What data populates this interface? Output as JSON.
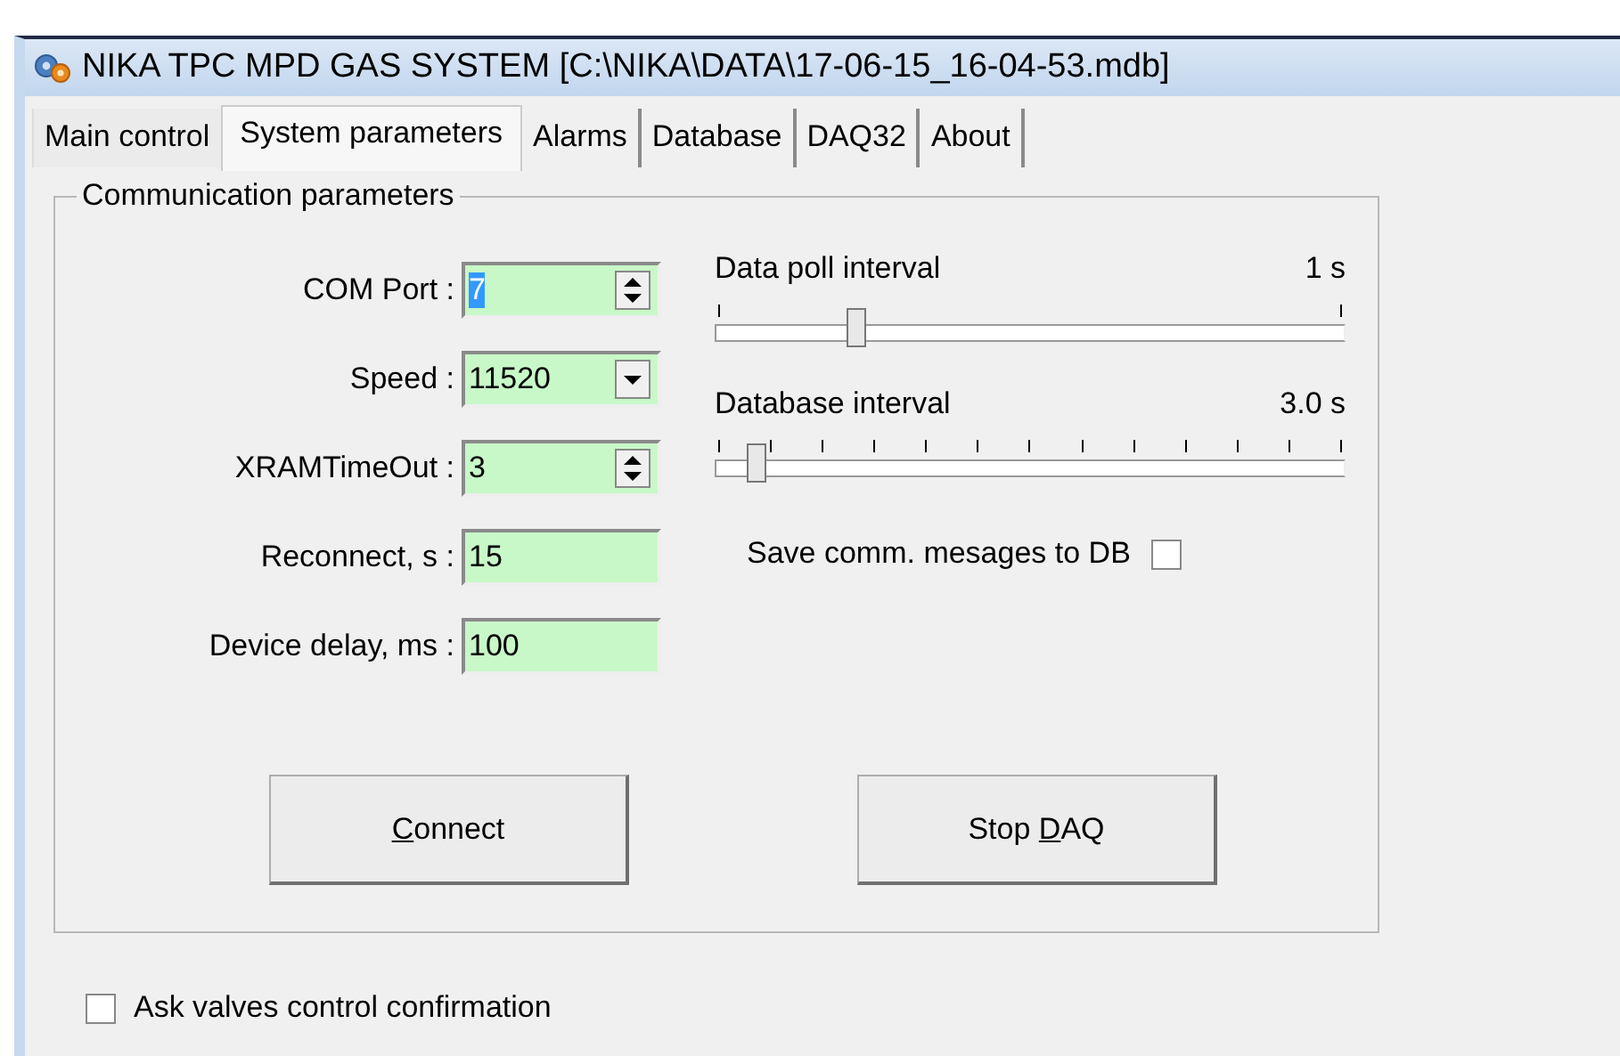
{
  "window": {
    "title": "NIKA TPC MPD GAS SYSTEM [C:\\NIKA\\DATA\\17-06-15_16-04-53.mdb]"
  },
  "tabs": [
    {
      "label": "Main control",
      "selected": false
    },
    {
      "label": "System parameters",
      "selected": true
    },
    {
      "label": "Alarms",
      "selected": false
    },
    {
      "label": "Database",
      "selected": false
    },
    {
      "label": "DAQ32",
      "selected": false
    },
    {
      "label": "About",
      "selected": false
    }
  ],
  "group": {
    "title": "Communication parameters",
    "fields": [
      {
        "label": "COM Port :",
        "kind": "spin",
        "value": "7",
        "text_selected": true
      },
      {
        "label": "Speed :",
        "kind": "combo",
        "value": "11520",
        "text_selected": false
      },
      {
        "label": "XRAMTimeOut :",
        "kind": "spin",
        "value": "3",
        "text_selected": false
      },
      {
        "label": "Reconnect, s :",
        "kind": "text",
        "value": "15",
        "text_selected": false
      },
      {
        "label": "Device delay, ms :",
        "kind": "text",
        "value": "100",
        "text_selected": false
      }
    ],
    "sliders": [
      {
        "label": "Data poll interval",
        "reading": "1 s",
        "level": 0.21
      },
      {
        "label": "Database interval",
        "reading": "3.0 s",
        "level": 0.05
      }
    ],
    "save_messages": {
      "label": "Save comm. mesages to DB",
      "checked": false
    },
    "buttons": [
      {
        "accel": "C",
        "after": "onnect"
      },
      {
        "before": "Stop ",
        "accel": "D",
        "after": "AQ"
      }
    ]
  },
  "ask_confirmation": {
    "label": "Ask valves control confirmation",
    "checked": false
  }
}
